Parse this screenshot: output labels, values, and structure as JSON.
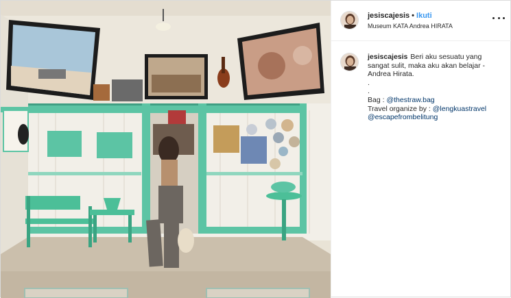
{
  "post": {
    "username": "jesiscajesis",
    "separator": "•",
    "follow_label": "Ikuti",
    "location": "Museum KATA Andrea HIRATA"
  },
  "caption": {
    "username": "jesiscajesis",
    "line1": "Beri aku sesuatu yang",
    "line2": "sangat sulit, maka aku akan belajar -",
    "line3": "Andrea Hirata.",
    "line4": ".",
    "line5": ".",
    "bag_prefix": "Bag : ",
    "bag_mention": "@thestraw.bag",
    "travel_prefix": "Travel organize by : ",
    "travel_mention": "@lengkuastravel",
    "travel_mention2": "@escapefrombelitung"
  },
  "icons": {
    "more": "more-options-icon",
    "avatar": "profile-avatar"
  },
  "colors": {
    "link": "#3897f0",
    "mention": "#003569",
    "text": "#262626",
    "border": "#dbdbdb",
    "room_trim": "#5cc4a4"
  }
}
